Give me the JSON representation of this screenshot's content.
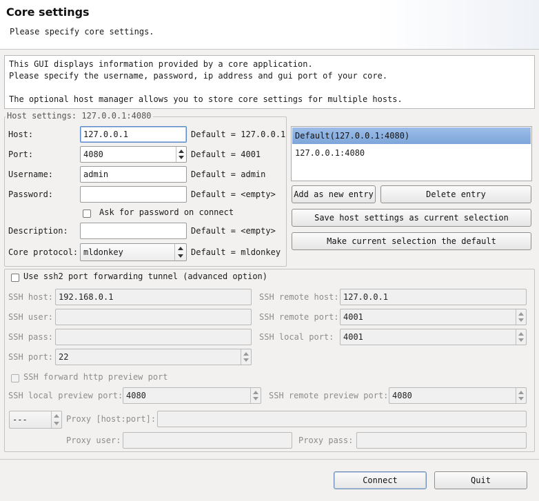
{
  "header": {
    "title": "Core settings",
    "subtitle": "Please specify core settings."
  },
  "info": {
    "lines": [
      "This GUI displays information provided by a core application.",
      "Please specify the username, password, ip address and gui port of your core.",
      "The optional host manager allows you to store core settings for multiple hosts."
    ]
  },
  "host_settings": {
    "legend": "Host settings: 127.0.0.1:4080",
    "host_label": "Host:",
    "host_value": "127.0.0.1",
    "host_default": "Default = 127.0.0.1",
    "port_label": "Port:",
    "port_value": "4080",
    "port_default": "Default = 4001",
    "username_label": "Username:",
    "username_value": "admin",
    "username_default": "Default = admin",
    "password_label": "Password:",
    "password_value": "",
    "password_default": "Default = <empty>",
    "ask_password_label": "Ask for password on connect",
    "ask_password_checked": false,
    "description_label": "Description:",
    "description_value": "",
    "description_default": "Default = <empty>",
    "protocol_label": "Core protocol:",
    "protocol_value": "mldonkey",
    "protocol_default": "Default = mldonkey"
  },
  "host_list": {
    "items": [
      "Default(127.0.0.1:4080)",
      "127.0.0.1:4080"
    ],
    "selected_index": 0,
    "add_button": "Add as new entry",
    "delete_button": "Delete entry",
    "save_button": "Save host settings as current selection",
    "default_button": "Make current selection the default"
  },
  "ssh": {
    "tunnel_label": "Use ssh2 port forwarding tunnel (advanced option)",
    "tunnel_checked": false,
    "host_label": "SSH host:",
    "host_value": "192.168.0.1",
    "remote_host_label": "SSH remote host:",
    "remote_host_value": "127.0.0.1",
    "user_label": "SSH user:",
    "user_value": "",
    "remote_port_label": "SSH remote port:",
    "remote_port_value": "4001",
    "pass_label": "SSH pass:",
    "pass_value": "",
    "local_port_label": "SSH local port:",
    "local_port_value": "4001",
    "port_label": "SSH port:",
    "port_value": "22",
    "forward_preview_label": "SSH forward http preview port",
    "local_preview_label": "SSH local preview port:",
    "local_preview_value": "4080",
    "remote_preview_label": "SSH remote preview port:",
    "remote_preview_value": "4080"
  },
  "proxy": {
    "type_value": "---",
    "hostport_label": "Proxy [host:port]:",
    "hostport_value": "",
    "user_label": "Proxy user:",
    "user_value": "",
    "pass_label": "Proxy pass:",
    "pass_value": ""
  },
  "footer": {
    "connect_button": "Connect",
    "quit_button": "Quit"
  }
}
